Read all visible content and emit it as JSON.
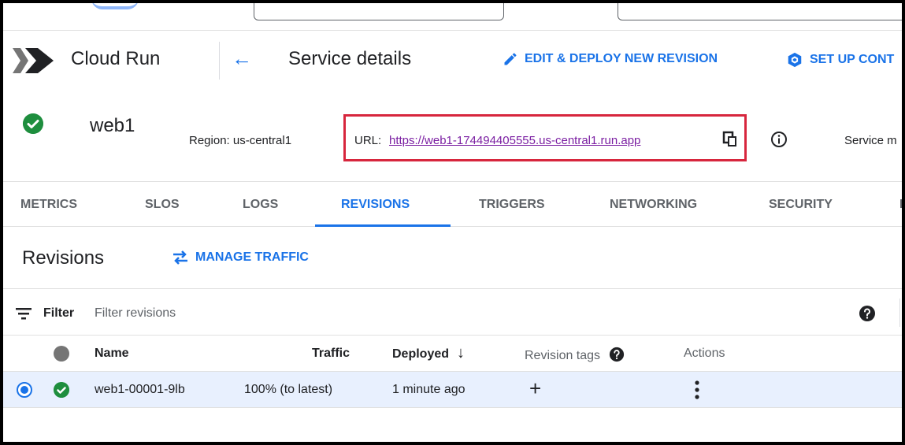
{
  "header": {
    "product_name": "Cloud Run",
    "page_title": "Service details",
    "edit_deploy_label": "EDIT & DEPLOY NEW REVISION",
    "setup_label": "SET UP CONT"
  },
  "service": {
    "name": "web1",
    "region": "Region: us-central1",
    "url_label": "URL:",
    "url": "https://web1-174494405555.us-central1.run.app",
    "service_more": "Service m"
  },
  "tabs": [
    {
      "label": "METRICS",
      "active": false
    },
    {
      "label": "SLOS",
      "active": false
    },
    {
      "label": "LOGS",
      "active": false
    },
    {
      "label": "REVISIONS",
      "active": true
    },
    {
      "label": "TRIGGERS",
      "active": false
    },
    {
      "label": "NETWORKING",
      "active": false
    },
    {
      "label": "SECURITY",
      "active": false
    },
    {
      "label": "I",
      "active": false
    }
  ],
  "revisions": {
    "title": "Revisions",
    "manage_traffic_label": "MANAGE TRAFFIC",
    "filter_label": "Filter",
    "filter_placeholder": "Filter revisions",
    "columns": {
      "name": "Name",
      "traffic": "Traffic",
      "deployed": "Deployed",
      "revision_tags": "Revision tags",
      "actions": "Actions"
    },
    "rows": [
      {
        "name": "web1-00001-9lb",
        "traffic": "100% (to latest)",
        "deployed": "1 minute ago"
      }
    ]
  },
  "colors": {
    "accent": "#1a73e8",
    "success": "#1e8e3e",
    "highlight_box": "#d7263d",
    "link_visited": "#7b1fa2"
  }
}
